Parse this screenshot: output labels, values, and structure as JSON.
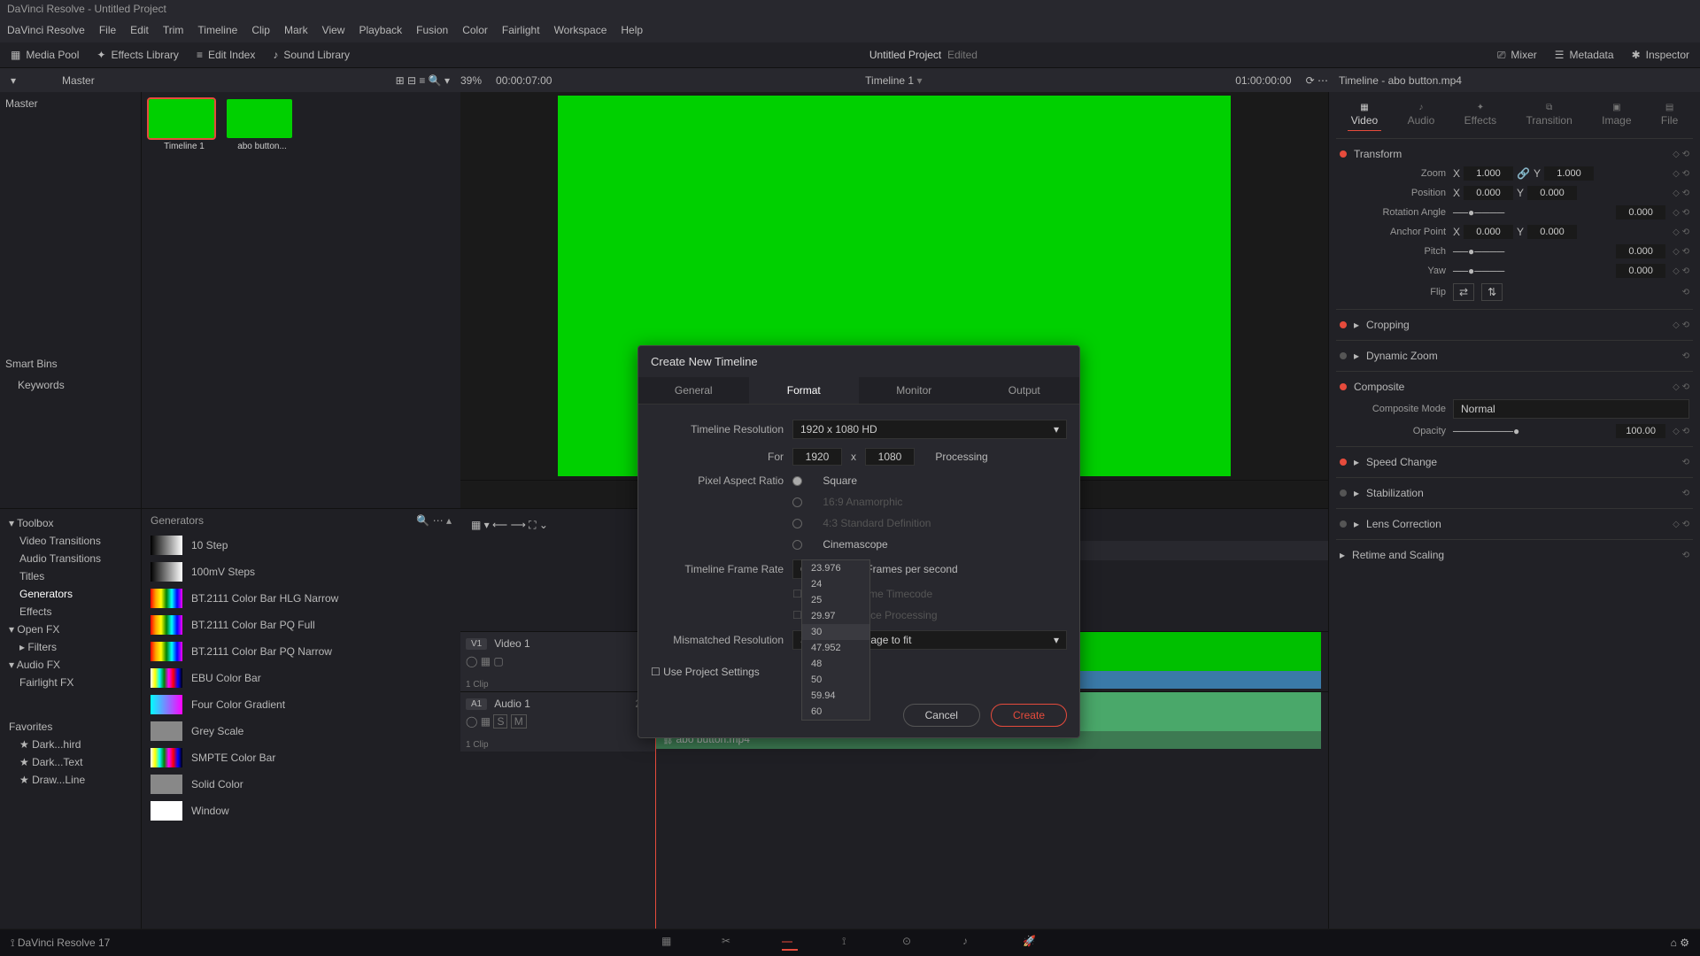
{
  "app": {
    "title": "DaVinci Resolve - Untitled Project",
    "name": "DaVinci Resolve 17"
  },
  "menu": [
    "DaVinci Resolve",
    "File",
    "Edit",
    "Trim",
    "Timeline",
    "Clip",
    "Mark",
    "View",
    "Playback",
    "Fusion",
    "Color",
    "Fairlight",
    "Workspace",
    "Help"
  ],
  "toolbar": {
    "mediaPool": "Media Pool",
    "effectsLib": "Effects Library",
    "editIndex": "Edit Index",
    "soundLib": "Sound Library",
    "projectTitle": "Untitled Project",
    "projectStatus": "Edited",
    "mixer": "Mixer",
    "metadata": "Metadata",
    "inspector": "Inspector"
  },
  "ruler": {
    "master": "Master",
    "zoom": "39%",
    "sourceTC": "00:00:07:00",
    "timelineName": "Timeline 1",
    "recordTC": "01:00:00:00",
    "inspTitle": "Timeline - abo button.mp4"
  },
  "bins": {
    "master": "Master",
    "smartBins": "Smart Bins",
    "keywords": "Keywords"
  },
  "clips": [
    {
      "label": "Timeline 1",
      "selected": true,
      "color": "#00d000"
    },
    {
      "label": "abo button...",
      "selected": false,
      "color": "#00d000"
    }
  ],
  "fx": {
    "header": "Generators",
    "tree": {
      "toolbox": "Toolbox",
      "videoTransitions": "Video Transitions",
      "audioTransitions": "Audio Transitions",
      "titles": "Titles",
      "generators": "Generators",
      "effects": "Effects",
      "openFX": "Open FX",
      "filters": "Filters",
      "audioFX": "Audio FX",
      "fairlightFX": "Fairlight FX",
      "favorites": "Favorites",
      "fav": [
        "Dark...hird",
        "Dark...Text",
        "Draw...Line"
      ]
    },
    "items": [
      "10 Step",
      "100mV Steps",
      "BT.2111 Color Bar HLG Narrow",
      "BT.2111 Color Bar PQ Full",
      "BT.2111 Color Bar PQ Narrow",
      "EBU Color Bar",
      "Four Color Gradient",
      "Grey Scale",
      "SMPTE Color Bar",
      "Solid Color",
      "Window"
    ]
  },
  "timeline": {
    "timecode": "01:00:00:00",
    "v1": {
      "badge": "V1",
      "name": "Video 1",
      "clips": "1 Clip"
    },
    "a1": {
      "badge": "A1",
      "name": "Audio 1",
      "level": "2.0",
      "clips": "1 Clip"
    },
    "clipName": "abo button.mp4"
  },
  "inspector": {
    "tabs": [
      "Video",
      "Audio",
      "Effects",
      "Transition",
      "Image",
      "File"
    ],
    "sections": {
      "transform": "Transform",
      "cropping": "Cropping",
      "dynamicZoom": "Dynamic Zoom",
      "composite": "Composite",
      "speedChange": "Speed Change",
      "stabilization": "Stabilization",
      "lensCorrection": "Lens Correction",
      "retime": "Retime and Scaling"
    },
    "props": {
      "zoom": "Zoom",
      "position": "Position",
      "rotation": "Rotation Angle",
      "anchor": "Anchor Point",
      "pitch": "Pitch",
      "yaw": "Yaw",
      "flip": "Flip",
      "compMode": "Composite Mode",
      "compVal": "Normal",
      "opacity": "Opacity",
      "opVal": "100.00"
    },
    "vals": {
      "one": "1.000",
      "zero": "0.000",
      "x": "X",
      "y": "Y"
    }
  },
  "dialog": {
    "title": "Create New Timeline",
    "tabs": {
      "general": "General",
      "format": "Format",
      "monitor": "Monitor",
      "output": "Output"
    },
    "labels": {
      "resolution": "Timeline Resolution",
      "for": "For",
      "x": "x",
      "processing": "Processing",
      "par": "Pixel Aspect Ratio",
      "frameRate": "Timeline Frame Rate",
      "fps": "Frames per second",
      "dropFrame": "Use Drop Frame Timecode",
      "interlace": "Enable Interlace Processing",
      "mismatched": "Mismatched Resolution",
      "scaleImage": "Scale entire image to fit",
      "useProjSettings": "Use Project Settings"
    },
    "par": {
      "square": "Square",
      "anamorphic": "16:9 Anamorphic",
      "sd": "4:3 Standard Definition",
      "cinemascope": "Cinemascope"
    },
    "values": {
      "resolution": "1920 x 1080 HD",
      "w": "1920",
      "h": "1080",
      "fps": "60"
    },
    "buttons": {
      "cancel": "Cancel",
      "create": "Create"
    }
  },
  "fpsOptions": [
    "23.976",
    "24",
    "25",
    "29.97",
    "30",
    "47.952",
    "48",
    "50",
    "59.94",
    "60"
  ]
}
